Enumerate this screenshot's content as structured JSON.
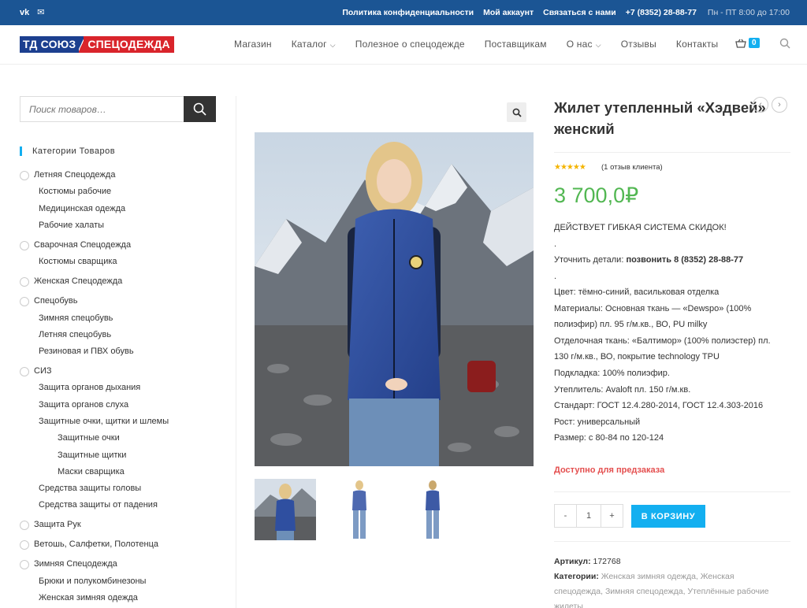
{
  "topbar": {
    "social": [
      "vk",
      "✉"
    ],
    "links": [
      "Политика конфиденциальности",
      "Мой аккаунт",
      "Связаться с нами",
      "+7 (8352) 28-88-77"
    ],
    "hours": "Пн - ПТ 8:00 до 17:00"
  },
  "logo": {
    "part1": "ТД СОЮЗ",
    "part2": "СПЕЦОДЕЖДА"
  },
  "nav": [
    "Магазин",
    "Каталог",
    "Полезное о спецодежде",
    "Поставщикам",
    "О нас",
    "Отзывы",
    "Контакты"
  ],
  "cart": {
    "count": "0"
  },
  "sidebar": {
    "search_placeholder": "Поиск товаров…",
    "categories_title": "Категории Товаров",
    "categories": [
      {
        "label": "Летняя Спецодежда",
        "level": 0
      },
      {
        "label": "Костюмы рабочие",
        "level": 1
      },
      {
        "label": "Медицинская одежда",
        "level": 1
      },
      {
        "label": "Рабочие халаты",
        "level": 1
      },
      {
        "label": "Сварочная Спецодежда",
        "level": 0
      },
      {
        "label": "Костюмы сварщика",
        "level": 1
      },
      {
        "label": "Женская Спецодежда",
        "level": 0
      },
      {
        "label": "Спецобувь",
        "level": 0
      },
      {
        "label": "Зимняя спецобувь",
        "level": 1
      },
      {
        "label": "Летняя спецобувь",
        "level": 1
      },
      {
        "label": "Резиновая и ПВХ обувь",
        "level": 1
      },
      {
        "label": "СИЗ",
        "level": 0
      },
      {
        "label": "Защита органов дыхания",
        "level": 1
      },
      {
        "label": "Защита органов слуха",
        "level": 1
      },
      {
        "label": "Защитные очки, щитки и шлемы",
        "level": 1
      },
      {
        "label": "Защитные очки",
        "level": 2
      },
      {
        "label": "Защитные щитки",
        "level": 2
      },
      {
        "label": "Маски сварщика",
        "level": 2
      },
      {
        "label": "Средства защиты головы",
        "level": 1
      },
      {
        "label": "Средства защиты от падения",
        "level": 1
      },
      {
        "label": "Защита Рук",
        "level": 0
      },
      {
        "label": "Ветошь, Салфетки, Полотенца",
        "level": 0
      },
      {
        "label": "Зимняя Спецодежда",
        "level": 0
      },
      {
        "label": "Брюки и полукомбинезоны",
        "level": 1
      },
      {
        "label": "Женская зимняя одежда",
        "level": 1
      }
    ]
  },
  "product": {
    "title": "Жилет утепленный «Хэдвей» женский",
    "reviews": "(1 отзыв клиента)",
    "price": "3 700,0₽",
    "discount": "ДЕЙСТВУЕТ ГИБКАЯ СИСТЕМА СКИДОК!",
    "dot": ".",
    "contact_prefix": "Уточнить детали: ",
    "contact_bold": "позвонить 8 (8352) 28-88-77",
    "details": [
      "Цвет: тёмно-синий, васильковая отделка",
      "Материалы: Основная ткань — «Dewspo» (100%",
      "полиэфир) пл. 95 г/м.кв., ВО, PU milky",
      "Отделочная ткань: «Балтимор» (100% полиэстер) пл.",
      "130 г/м.кв., ВО, покрытие technology TPU",
      "Подкладка: 100% полиэфир.",
      "Утеплитель: Avaloft пл. 150 г/м.кв.",
      "Стандарт: ГОСТ 12.4.280-2014, ГОСТ 12.4.303-2016",
      "Рост: универсальный",
      "Размер: с 80-84 по 120-124"
    ],
    "availability": "Доступно для предзаказа",
    "qty": "1",
    "minus": "-",
    "plus": "+",
    "add_to_cart": "В КОРЗИНУ",
    "sku_label": "Артикул: ",
    "sku": "172768",
    "cat_label": "Категории: ",
    "cat_line1": "Женская зимняя одежда, Женская",
    "cat_line2": "спецодежда, Зимняя спецодежда, Утеплённые рабочие",
    "cat_line3": "жилеты"
  },
  "colors": {
    "topbar": "#1b5594",
    "accent": "#13aff0",
    "price": "#52b752",
    "availability": "#e44e4e"
  }
}
